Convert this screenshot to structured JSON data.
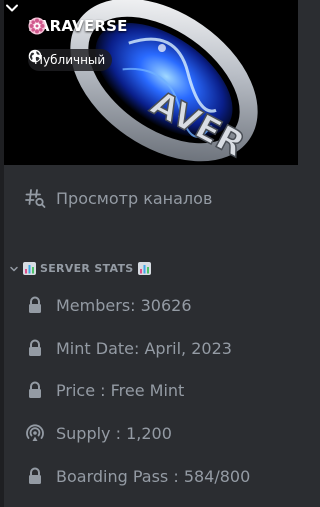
{
  "server": {
    "name": "PARAVERSE",
    "visibility": "Публичный",
    "banner_text": "AVER"
  },
  "browse": {
    "label": "Просмотр каналов",
    "icon": "browse-channels-icon"
  },
  "category": {
    "label": "SERVER STATS",
    "icon": "bar-chart-emoji"
  },
  "channels": [
    {
      "label": "Members: 30626",
      "icon": "lock-icon"
    },
    {
      "label": "Mint Date: April, 2023",
      "icon": "lock-icon"
    },
    {
      "label": "Price : Free Mint",
      "icon": "lock-icon"
    },
    {
      "label": "Supply : 1,200",
      "icon": "stage-icon"
    },
    {
      "label": "Boarding Pass : 584/800",
      "icon": "lock-icon"
    }
  ],
  "colors": {
    "sidebar_bg": "#2b2d31",
    "text_muted": "#949ba4",
    "text_white": "#ffffff",
    "badge_bg": "#1e1f22"
  }
}
